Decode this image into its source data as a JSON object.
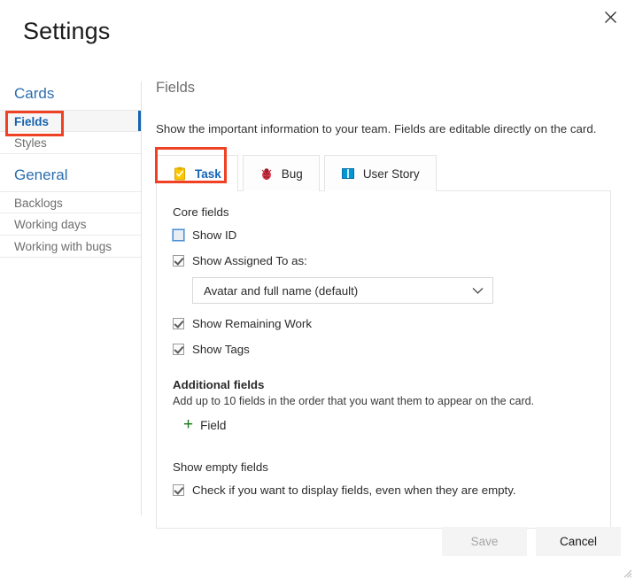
{
  "dialog": {
    "title": "Settings",
    "close_icon": "close-icon"
  },
  "sidebar": {
    "groups": [
      {
        "title": "Cards",
        "items": [
          {
            "label": "Fields",
            "selected": true
          },
          {
            "label": "Styles",
            "selected": false
          }
        ]
      },
      {
        "title": "General",
        "items": [
          {
            "label": "Backlogs",
            "selected": false
          },
          {
            "label": "Working days",
            "selected": false
          },
          {
            "label": "Working with bugs",
            "selected": false
          }
        ]
      }
    ]
  },
  "main": {
    "panel_title": "Fields",
    "panel_description": "Show the important information to your team. Fields are editable directly on the card.",
    "tabs": [
      {
        "label": "Task",
        "icon": "task-clipboard-icon",
        "active": true
      },
      {
        "label": "Bug",
        "icon": "bug-ladybug-icon",
        "active": false
      },
      {
        "label": "User Story",
        "icon": "user-story-book-icon",
        "active": false
      }
    ],
    "core_fields": {
      "heading": "Core fields",
      "show_id": {
        "label": "Show ID",
        "checked": false,
        "focused": true
      },
      "show_assigned_to": {
        "label": "Show Assigned To as:",
        "checked": true
      },
      "assigned_to_select": {
        "value": "Avatar and full name (default)",
        "chevron": "chevron-down-icon"
      },
      "show_remaining_work": {
        "label": "Show Remaining Work",
        "checked": true
      },
      "show_tags": {
        "label": "Show Tags",
        "checked": true
      }
    },
    "additional_fields": {
      "heading": "Additional fields",
      "hint": "Add up to 10 fields in the order that you want them to appear on the card.",
      "add_label": "Field",
      "add_icon": "plus-icon"
    },
    "show_empty_fields": {
      "heading": "Show empty fields",
      "checkbox": {
        "label": "Check if you want to display fields, even when they are empty.",
        "checked": true
      }
    }
  },
  "footer": {
    "save_label": "Save",
    "save_disabled": true,
    "cancel_label": "Cancel"
  },
  "colors": {
    "accent_blue": "#1164b0",
    "link_blue": "#2a6db0",
    "annotation_red": "#ef4123",
    "plus_green": "#107c10",
    "bug_red": "#e23c50",
    "task_yellow": "#ffc700",
    "story_blue": "#0097d8"
  }
}
